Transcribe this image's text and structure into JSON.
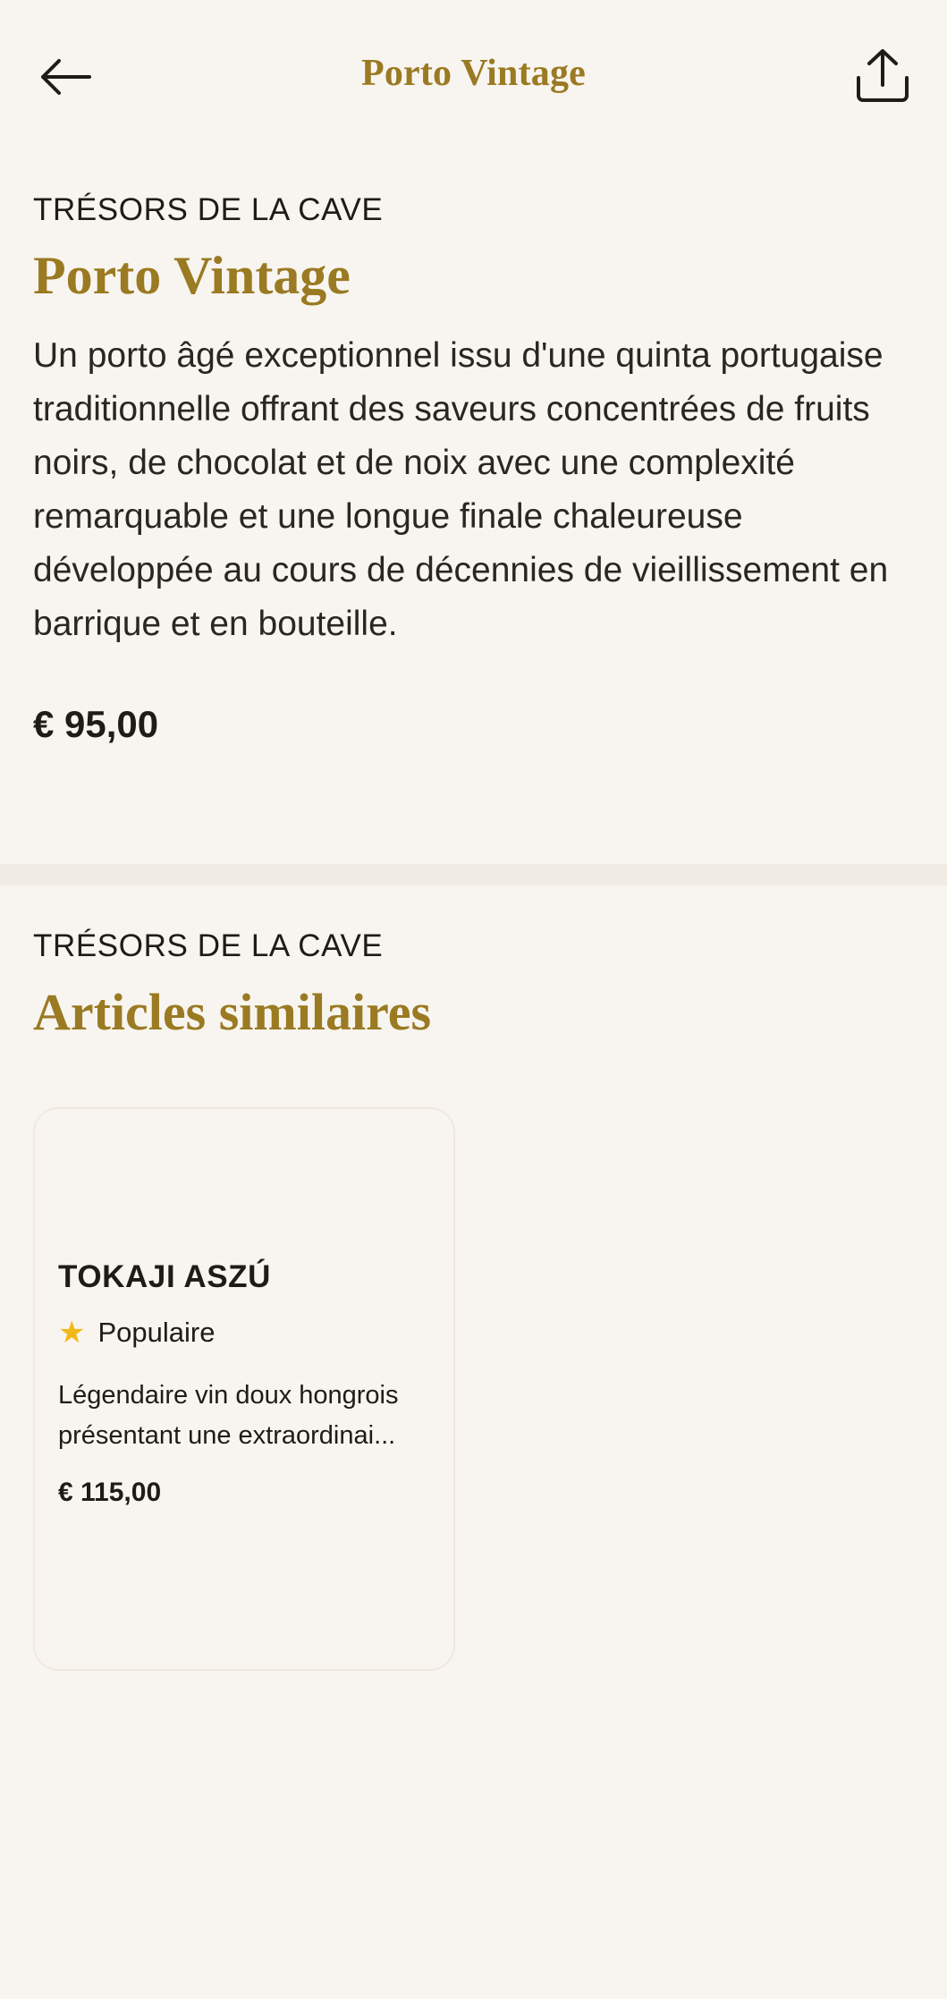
{
  "header": {
    "title": "Porto Vintage",
    "back_icon": "arrow-left-icon",
    "share_icon": "share-icon"
  },
  "product": {
    "eyebrow": "TRÉSORS DE LA CAVE",
    "name": "Porto Vintage",
    "description": "Un porto âgé exceptionnel issu d'une quinta portugaise traditionnelle offrant des saveurs concentrées de fruits noirs, de chocolat et de noix avec une complexité remarquable et une longue finale chaleureuse développée au cours de décennies de vieillissement en barrique et en bouteille.",
    "price": "€ 95,00"
  },
  "similar": {
    "eyebrow": "TRÉSORS DE LA CAVE",
    "heading": "Articles similaires",
    "items": [
      {
        "name": "TOKAJI ASZÚ",
        "badge": "Populaire",
        "badge_icon": "star-icon",
        "description": "Légendaire vin doux hongrois présentant une extraordinai...",
        "price": "€ 115,00"
      }
    ]
  },
  "colors": {
    "background": "#f8f5f0",
    "accent": "#9a7a22",
    "text": "#1f1c17",
    "star": "#f2b818",
    "divider": "#f1ece3"
  }
}
